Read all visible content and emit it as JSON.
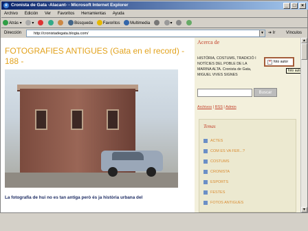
{
  "window": {
    "title": "Cronista de Gata -Alacant- - Microsoft Internet Explorer"
  },
  "menu": [
    "Archivo",
    "Edición",
    "Ver",
    "Favoritos",
    "Herramientas",
    "Ayuda"
  ],
  "toolbar": {
    "back": "Atrás",
    "search": "Búsqueda",
    "favorites": "Favoritos",
    "multimedia": "Multimedia"
  },
  "address": {
    "label": "Dirección",
    "url": "http://cronistadegata.blogia.com/",
    "go": "Ir",
    "links": "Vínculos"
  },
  "post": {
    "title": "FOTOGRAFIES ANTIGUES (Gata en el record) - 188 -",
    "text": "La fotografia de hui no es tan antiga però és ja història urbana del"
  },
  "sidebar": {
    "heading": "Acerca de",
    "about": "HISTÒRIA, COSTUMS, TRADICIÓ I NOTÍCIES DEL POBLE DE LA MARINA ALTA. Cronista de Gata, MIGUEL VIVES SIGNES",
    "photo_label": "foto autor",
    "tooltip": "foto autor",
    "search_button": "Buscar",
    "links": [
      "Archivos",
      "RSS",
      "Admin"
    ],
    "temes_heading": "Temas",
    "temes": [
      "ACTES",
      "COM ES VA FER...?",
      "COSTUMS",
      "CRONISTA",
      "ESPORTS",
      "FESTES",
      "FOTOS ANTIGUES"
    ]
  }
}
